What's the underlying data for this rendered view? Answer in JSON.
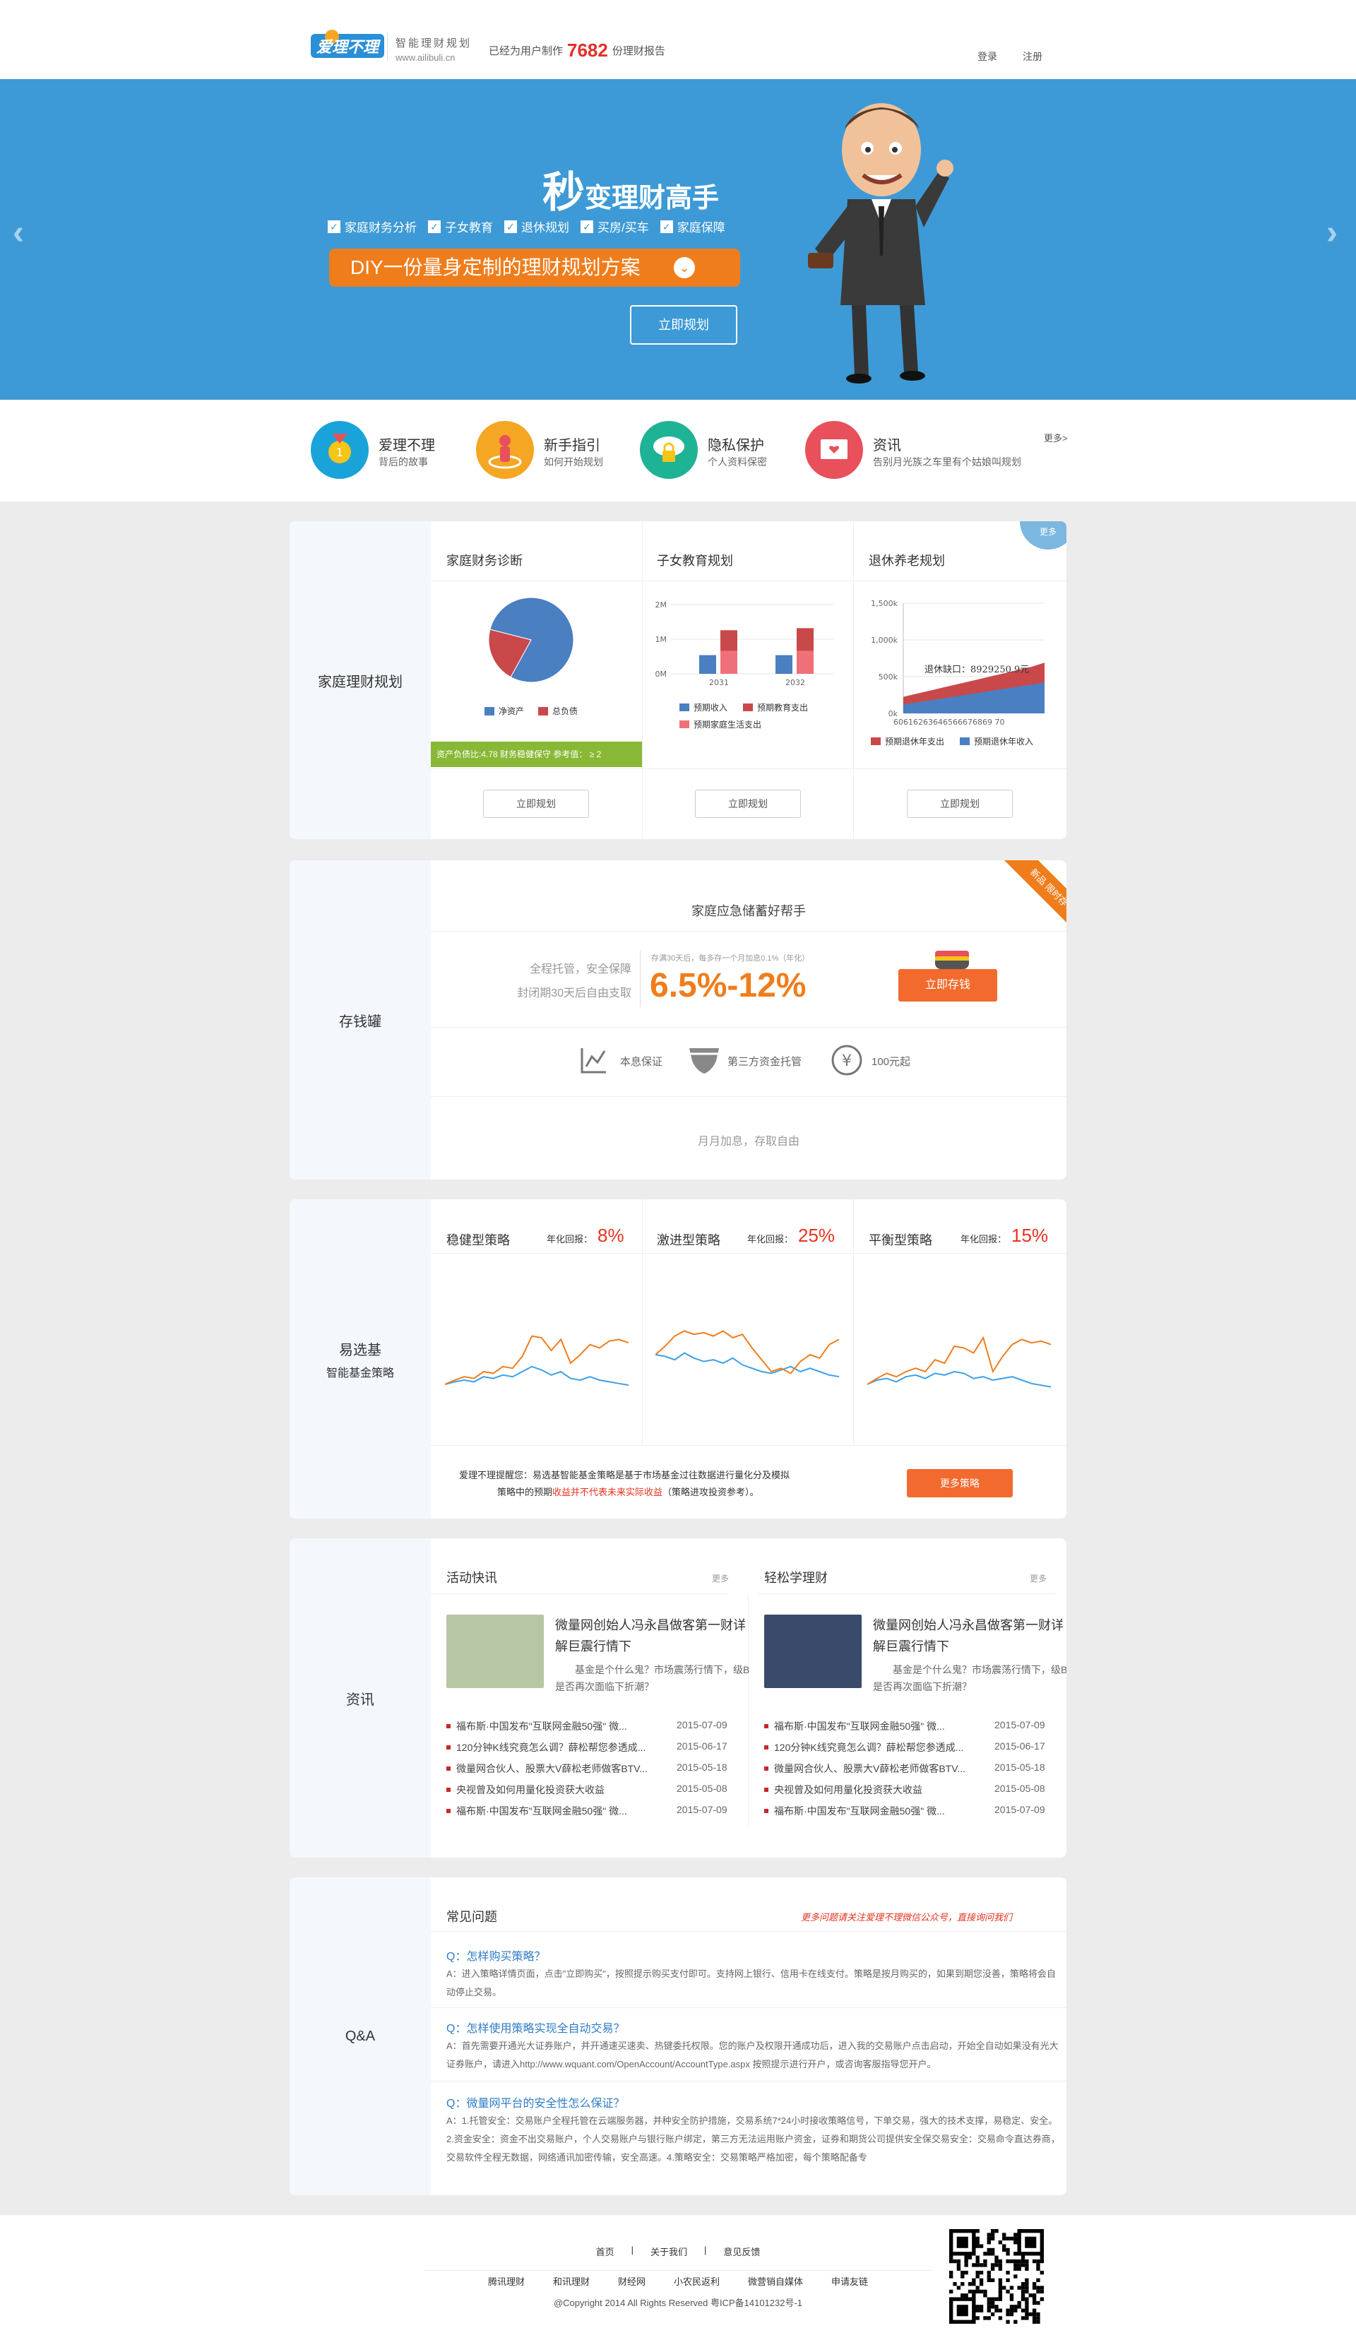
{
  "header": {
    "logo_text": "爱理不理",
    "tagline": "智能理财规划",
    "url": "www.ailibuli.cn",
    "report_prefix": "已经为用户制作",
    "report_count": "7682",
    "report_suffix": "份理财报告",
    "login": "登录",
    "register": "注册"
  },
  "banner": {
    "arrow_left": "‹",
    "arrow_right": "›",
    "slogan_first": "秒",
    "slogan_rest": "变理财高手",
    "features": [
      "家庭财务分析",
      "子女教育",
      "退休规划",
      "买房/买车",
      "家庭保障"
    ],
    "diy_text": "DIY一份量身定制的理财规划方案",
    "plan_button": "立即规划"
  },
  "feature_row": {
    "items": [
      {
        "title": "爱理不理",
        "sub": "背后的故事",
        "color": "#1aa3d9",
        "icon": "medal-icon"
      },
      {
        "title": "新手指引",
        "sub": "如何开始规划",
        "color": "#f5a623",
        "icon": "target-person-icon"
      },
      {
        "title": "隐私保护",
        "sub": "个人资料保密",
        "color": "#1fb396",
        "icon": "cloud-lock-icon"
      },
      {
        "title": "资讯",
        "sub": "告别月光族之车里有个姑娘叫规划",
        "color": "#e8505b",
        "icon": "mail-heart-icon"
      }
    ],
    "more": "更多>"
  },
  "planning": {
    "side_title": "家庭理财规划",
    "more_badge": "更多",
    "columns": [
      {
        "title": "家庭财务诊断",
        "button": "立即规划"
      },
      {
        "title": "子女教育规划",
        "button": "立即规划"
      },
      {
        "title": "退休养老规划",
        "button": "立即规划"
      }
    ],
    "diagnosis_note": "资产负债比:4.78  财务稳健保守  参考值： ≥ 2"
  },
  "chart_data": [
    {
      "type": "pie",
      "title": "家庭财务诊断",
      "categories": [
        "净资产",
        "总负债"
      ],
      "values": [
        79,
        21
      ],
      "colors": [
        "#4a7fc1",
        "#c9494b"
      ]
    },
    {
      "type": "bar",
      "title": "子女教育规划",
      "categories": [
        "2031",
        "2032"
      ],
      "ylabels": [
        "2M",
        "1M",
        "0M"
      ],
      "series": [
        {
          "name": "预期收入",
          "values": [
            0.45,
            0.45
          ],
          "color": "#4a7fc1"
        },
        {
          "name": "预期教育支出",
          "values": [
            0.5,
            0.55
          ],
          "color": "#c9494b"
        },
        {
          "name": "预期家庭生活支出",
          "values": [
            0.55,
            0.55
          ],
          "color": "#f0707a"
        }
      ]
    },
    {
      "type": "area",
      "title": "退休养老规划",
      "ylabels": [
        "1,500k",
        "1,000k",
        "500k",
        "0k"
      ],
      "xlabels": "60616263646566676869 70",
      "annotation": "退休缺口：8929250.9元",
      "series": [
        {
          "name": "预期退休年支出",
          "values": [
            0.15,
            0.18,
            0.21,
            0.24,
            0.27,
            0.3,
            0.33,
            0.36,
            0.39,
            0.42,
            0.46
          ],
          "color": "#c9494b"
        },
        {
          "name": "预期退休年收入",
          "values": [
            0.08,
            0.1,
            0.12,
            0.14,
            0.16,
            0.18,
            0.2,
            0.22,
            0.24,
            0.26,
            0.28
          ],
          "color": "#4a7fc1"
        }
      ]
    },
    {
      "type": "line",
      "title": "稳健型策略",
      "series": [
        {
          "name": "orange",
          "color": "#f07d1c",
          "values": [
            0.15,
            0.2,
            0.24,
            0.22,
            0.3,
            0.28,
            0.36,
            0.34,
            0.48,
            0.72,
            0.7,
            0.55,
            0.68,
            0.4,
            0.5,
            0.62,
            0.58,
            0.66,
            0.68,
            0.64
          ]
        },
        {
          "name": "blue",
          "color": "#3ca0e8",
          "values": [
            0.15,
            0.18,
            0.2,
            0.18,
            0.24,
            0.22,
            0.26,
            0.24,
            0.3,
            0.36,
            0.32,
            0.26,
            0.3,
            0.22,
            0.2,
            0.24,
            0.2,
            0.18,
            0.16,
            0.14
          ]
        }
      ]
    },
    {
      "type": "line",
      "title": "激进型策略",
      "series": [
        {
          "name": "orange",
          "color": "#f07d1c",
          "values": [
            0.5,
            0.6,
            0.72,
            0.78,
            0.74,
            0.76,
            0.72,
            0.78,
            0.7,
            0.74,
            0.58,
            0.44,
            0.3,
            0.34,
            0.28,
            0.42,
            0.5,
            0.46,
            0.62,
            0.68
          ]
        },
        {
          "name": "blue",
          "color": "#3ca0e8",
          "values": [
            0.5,
            0.48,
            0.44,
            0.52,
            0.46,
            0.42,
            0.44,
            0.4,
            0.46,
            0.38,
            0.34,
            0.3,
            0.28,
            0.32,
            0.36,
            0.3,
            0.34,
            0.3,
            0.26,
            0.24
          ]
        }
      ]
    },
    {
      "type": "line",
      "title": "平衡型策略",
      "series": [
        {
          "name": "orange",
          "color": "#f07d1c",
          "values": [
            0.15,
            0.22,
            0.28,
            0.24,
            0.3,
            0.34,
            0.3,
            0.44,
            0.4,
            0.6,
            0.58,
            0.52,
            0.7,
            0.3,
            0.48,
            0.62,
            0.68,
            0.64,
            0.66,
            0.62
          ]
        },
        {
          "name": "blue",
          "color": "#3ca0e8",
          "values": [
            0.15,
            0.2,
            0.22,
            0.18,
            0.24,
            0.26,
            0.22,
            0.28,
            0.26,
            0.3,
            0.28,
            0.22,
            0.24,
            0.2,
            0.22,
            0.24,
            0.2,
            0.16,
            0.14,
            0.12
          ]
        }
      ]
    }
  ],
  "piggy": {
    "side_title": "存钱罐",
    "header": "家庭应急储蓄好帮手",
    "ribbon": "新品 限时存",
    "left_line1": "全程托管，安全保障",
    "left_line2": "封闭期30天后自由支取",
    "small_note": "存满30天后，每多存一个月加息0.1%（年化）",
    "rate": "6.5%-12%",
    "deposit_button": "立即存钱",
    "guarantees": [
      "本息保证",
      "第三方资金托管",
      "100元起"
    ],
    "footer_text": "月月加息，存取自由"
  },
  "funds": {
    "side_title": "易选基",
    "side_sub": "智能基金策略",
    "strategies": [
      {
        "name": "稳健型策略",
        "label": "年化回报：",
        "rate": "8%"
      },
      {
        "name": "激进型策略",
        "label": "年化回报：",
        "rate": "25%"
      },
      {
        "name": "平衡型策略",
        "label": "年化回报：",
        "rate": "15%"
      }
    ],
    "desc_line1": "爱理不理提醒您：易选基智能基金策略是基于市场基金过往数据进行量化分及模拟",
    "desc_line2_a": "策略中的预期",
    "desc_line2_red": "收益并不代表未来实际收益",
    "desc_line2_b": "（策略进攻投资参考）。",
    "more_button": "更多策略"
  },
  "news": {
    "side_title": "资讯",
    "columns": [
      {
        "title": "活动快讯",
        "more": "更多",
        "headline": "微量网创始人冯永昌做客第一财详解巨震行情下",
        "summary": "基金是个什么鬼？市场震荡行情下，级B是否再次面临下折潮？",
        "items": [
          {
            "text": "福布斯·中国发布\"互联网金融50强\" 微...",
            "date": "2015-07-09"
          },
          {
            "text": "120分钟K线究竟怎么调？薛松帮您参透成...",
            "date": "2015-06-17"
          },
          {
            "text": "微量网合伙人、股票大V薛松老师做客BTV...",
            "date": "2015-05-18"
          },
          {
            "text": "央视曾及如何用量化投资获大收益",
            "date": "2015-05-08"
          },
          {
            "text": "福布斯·中国发布\"互联网金融50强\" 微...",
            "date": "2015-07-09"
          }
        ]
      },
      {
        "title": "轻松学理财",
        "more": "更多",
        "headline": "微量网创始人冯永昌做客第一财详解巨震行情下",
        "summary": "基金是个什么鬼？市场震荡行情下，级B是否再次面临下折潮？",
        "items": [
          {
            "text": "福布斯·中国发布\"互联网金融50强\" 微...",
            "date": "2015-07-09"
          },
          {
            "text": "120分钟K线究竟怎么调？薛松帮您参透成...",
            "date": "2015-06-17"
          },
          {
            "text": "微量网合伙人、股票大V薛松老师做客BTV...",
            "date": "2015-05-18"
          },
          {
            "text": "央视曾及如何用量化投资获大收益",
            "date": "2015-05-08"
          },
          {
            "text": "福布斯·中国发布\"互联网金融50强\" 微...",
            "date": "2015-07-09"
          }
        ]
      }
    ]
  },
  "qa": {
    "side_title": "Q&A",
    "title": "常见问题",
    "notice": "更多问题请关注爱理不理微信公众号，直接询问我们",
    "items": [
      {
        "q": "Q：怎样购买策略？",
        "a": "A：进入策略详情页面，点击\"立即购买\"，按照提示购买支付即可。支持网上银行、信用卡在线支付。策略是按月购买的，如果到期您没善，策略将会自动停止交易。"
      },
      {
        "q": "Q：怎样使用策略实现全自动交易？",
        "a": "A：首先需要开通光大证券账户，并开通速买速卖、热键委托权限。您的账户及权限开通成功后，进入我的交易账户点击启动，开始全自动如果没有光大证券账户，请进入http://www.wquant.com/OpenAccount/AccountType.aspx 按照提示进行开户，或咨询客服指导您开户。"
      },
      {
        "q": "Q：微量网平台的安全性怎么保证？",
        "a": "A：1.托管安全：交易账户全程托管在云端服务器，并种安全防护措施，交易系统7*24小时接收策略信号，下单交易，强大的技术支撑，易稳定、安全。2.资金安全：资金不出交易账户，个人交易账户与银行账户绑定，第三方无法运用账户资金，证券和期货公司提供安全保交易安全：交易命令直达券商，交易软件全程无数据，网络通讯加密传输，安全高速。4.策略安全：交易策略严格加密，每个策略配备专"
      }
    ]
  },
  "footer": {
    "links1": [
      "首页",
      "关于我们",
      "意见反馈"
    ],
    "links2": [
      "腾讯理财",
      "和讯理财",
      "财经网",
      "小农民返利",
      "微营销自媒体",
      "申请友链"
    ],
    "copyright": "@Copyright 2014 All Rights Reserved 粤ICP备14101232号-1"
  }
}
